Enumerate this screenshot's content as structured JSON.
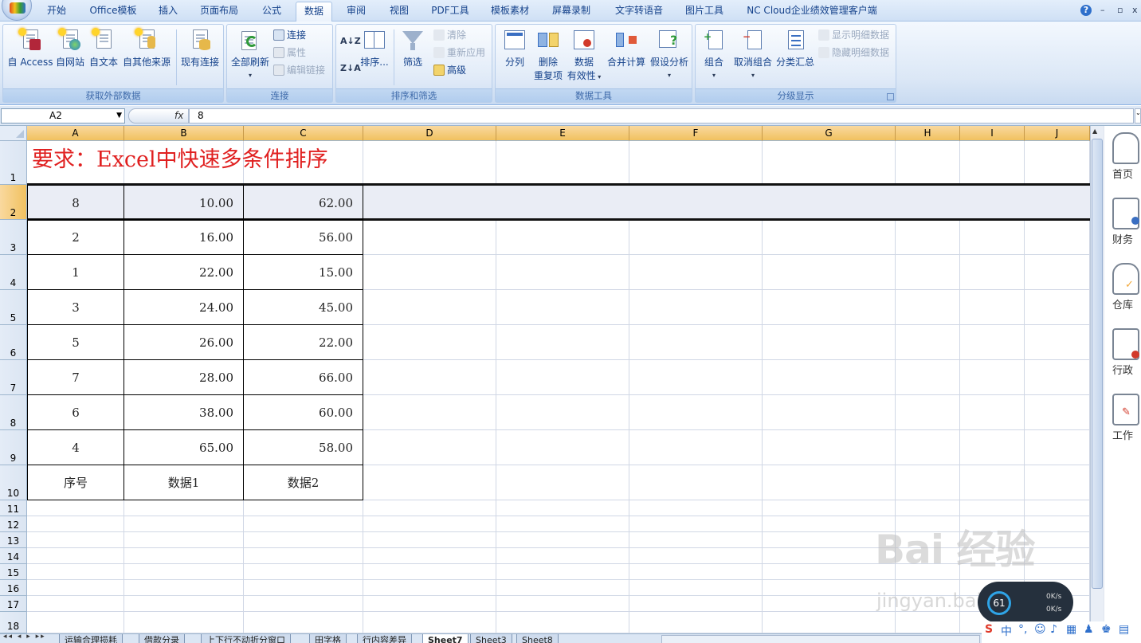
{
  "menu": {
    "tabs": [
      "开始",
      "Office模板",
      "插入",
      "页面布局",
      "公式",
      "数据",
      "审阅",
      "视图",
      "PDF工具",
      "模板素材",
      "屏幕录制",
      "文字转语音",
      "图片工具",
      "NC Cloud企业绩效管理客户端"
    ],
    "active_tab": "数据",
    "help": "?",
    "minimize": "–",
    "restore": "▫",
    "close": "x"
  },
  "ribbon": {
    "groups": {
      "external": {
        "label": "获取外部数据",
        "access": "自 Access",
        "web": "自网站",
        "text": "自文本",
        "other": "自其他来源",
        "existing": "现有连接"
      },
      "connections": {
        "label": "连接",
        "refresh_all": "全部刷新",
        "connections": "连接",
        "properties": "属性",
        "edit_links": "编辑链接"
      },
      "sortfilter": {
        "label": "排序和筛选",
        "sort_az": "A↓Z",
        "sort_za": "Z↓A",
        "sort": "排序...",
        "filter": "筛选",
        "clear": "清除",
        "reapply": "重新应用",
        "advanced": "高级"
      },
      "datatools": {
        "label": "数据工具",
        "text_to_columns": "分列",
        "remove_dup_1": "删除",
        "remove_dup_2": "重复项",
        "validation_1": "数据",
        "validation_2": "有效性",
        "consolidate": "合并计算",
        "whatif": "假设分析"
      },
      "outline": {
        "label": "分级显示",
        "group": "组合",
        "ungroup": "取消组合",
        "subtotal": "分类汇总",
        "show_detail": "显示明细数据",
        "hide_detail": "隐藏明细数据"
      }
    }
  },
  "formula_bar": {
    "name_box": "A2",
    "fx": "fx",
    "content": "8"
  },
  "sheet": {
    "columns": [
      "A",
      "B",
      "C",
      "D",
      "E",
      "F",
      "G",
      "H",
      "I",
      "J"
    ],
    "rows": [
      "1",
      "2",
      "3",
      "4",
      "5",
      "6",
      "7",
      "8",
      "9",
      "10",
      "11",
      "12",
      "13",
      "14",
      "15",
      "16",
      "17",
      "18"
    ],
    "title": "要求：Excel中快速多条件排序",
    "table": [
      [
        "8",
        "10.00",
        "62.00"
      ],
      [
        "2",
        "16.00",
        "56.00"
      ],
      [
        "1",
        "22.00",
        "15.00"
      ],
      [
        "3",
        "24.00",
        "45.00"
      ],
      [
        "5",
        "26.00",
        "22.00"
      ],
      [
        "7",
        "28.00",
        "66.00"
      ],
      [
        "6",
        "38.00",
        "60.00"
      ],
      [
        "4",
        "65.00",
        "58.00"
      ],
      [
        "序号",
        "数据1",
        "数据2"
      ]
    ]
  },
  "side_panel": [
    "首页",
    "财务",
    "仓库",
    "行政",
    "工作"
  ],
  "sheet_tabs": [
    "运输合理损耗",
    "借款分录",
    "上下行不动折分窗口",
    "田字格",
    "行内容差异",
    "Sheet7",
    "Sheet3",
    "Sheet8"
  ],
  "active_sheet": "Sheet7",
  "watermark": {
    "main": "Bai 经验",
    "sub": "jingyan.baidu.com"
  },
  "net_widget": {
    "percent": "61",
    "up": "0K/s",
    "down": "0K/s"
  },
  "tray": {
    "ime": "中"
  },
  "colors": {
    "title_red": "#e02020",
    "header_orange": "#f1c15f",
    "ribbon_blue": "#dbe7f6"
  }
}
